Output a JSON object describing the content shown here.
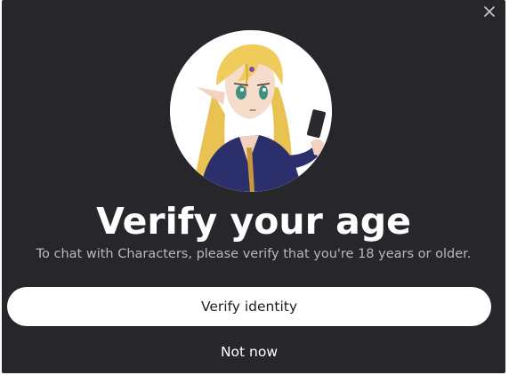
{
  "dialog": {
    "close_icon": "close-icon",
    "avatar": "anime-elf-character-holding-phone",
    "title": "Verify your age",
    "subtitle": "To chat with Characters, please verify that you're 18 years or older.",
    "verify_label": "Verify identity",
    "not_now_label": "Not now"
  },
  "colors": {
    "background": "#27272b",
    "primary_button": "#ffffff",
    "subtitle_text": "#b8b8bd"
  }
}
